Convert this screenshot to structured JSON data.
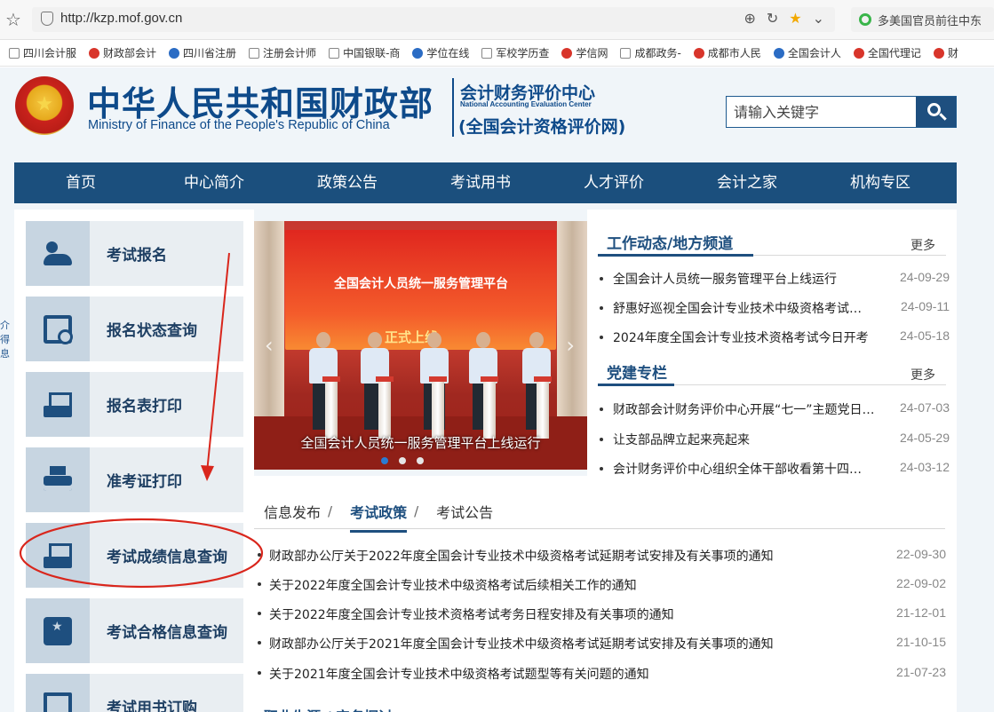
{
  "browser": {
    "url": "http://kzp.mof.gov.cn",
    "news_ticker": "多美国官员前往中东",
    "bookmarks": [
      "四川会计服",
      "财政部会计",
      "四川省注册",
      "注册会计师",
      "中国银联-商",
      "学位在线",
      "军校学历查",
      "学信网",
      "成都政务-",
      "成都市人民",
      "全国会计人",
      "全国代理记",
      "财"
    ]
  },
  "header": {
    "title_cn": "中华人民共和国财政部",
    "title_en": "Ministry of Finance of the People's Republic of China",
    "center_cn": "会计财务评价中心",
    "center_en": "National Accounting Evaluation Center",
    "center_sub": "(全国会计资格评价网)",
    "search_placeholder": "请输入关键字"
  },
  "nav": [
    "首页",
    "中心简介",
    "政策公告",
    "考试用书",
    "人才评价",
    "会计之家",
    "机构专区"
  ],
  "menu": [
    {
      "label": "考试报名",
      "icon": "people-icon"
    },
    {
      "label": "报名状态查询",
      "icon": "document-search-icon"
    },
    {
      "label": "报名表打印",
      "icon": "tray-icon"
    },
    {
      "label": "准考证打印",
      "icon": "printer-icon"
    },
    {
      "label": "考试成绩信息查询",
      "icon": "tray-icon"
    },
    {
      "label": "考试合格信息查询",
      "icon": "badge-icon"
    },
    {
      "label": "考试用书订购",
      "icon": "book-icon"
    }
  ],
  "slider": {
    "screen_title": "全国会计人员统一服务管理平台",
    "screen_sub": "正式上线",
    "caption": "全国会计人员统一服务管理平台上线运行"
  },
  "work": {
    "title": "工作动态/地方频道",
    "more": "更多",
    "items": [
      {
        "text": "全国会计人员统一服务管理平台上线运行",
        "date": "24-09-29"
      },
      {
        "text": "舒惠好巡视全国会计专业技术中级资格考试…",
        "date": "24-09-11"
      },
      {
        "text": "2024年度全国会计专业技术资格考试今日开考",
        "date": "24-05-18"
      }
    ]
  },
  "party": {
    "title": "党建专栏",
    "more": "更多",
    "items": [
      {
        "text": "财政部会计财务评价中心开展“七一”主题党日…",
        "date": "24-07-03"
      },
      {
        "text": "让支部品牌立起来亮起来",
        "date": "24-05-29"
      },
      {
        "text": "会计财务评价中心组织全体干部收看第十四…",
        "date": "24-03-12"
      }
    ]
  },
  "tabs": [
    "信息发布",
    "考试政策",
    "考试公告"
  ],
  "tab_sep": "/",
  "notices": [
    {
      "text": "财政部办公厅关于2022年度全国会计专业技术中级资格考试延期考试安排及有关事项的通知",
      "date": "22-09-30"
    },
    {
      "text": "关于2022年度全国会计专业技术中级资格考试后续相关工作的通知",
      "date": "22-09-02"
    },
    {
      "text": "关于2022年度全国会计专业技术资格考试考务日程安排及有关事项的通知",
      "date": "21-12-01"
    },
    {
      "text": "财政部办公厅关于2021年度全国会计专业技术中级资格考试延期考试安排及有关事项的通知",
      "date": "21-10-15"
    },
    {
      "text": "关于2021年度全国会计专业技术中级资格考试题型等有关问题的通知",
      "date": "21-07-23"
    }
  ],
  "next_section": "职业生涯 /   实务探讨",
  "edge_fragment": "介\n得\n息",
  "colors": {
    "primary": "#1b4f7d",
    "annotation": "#d9261c"
  }
}
